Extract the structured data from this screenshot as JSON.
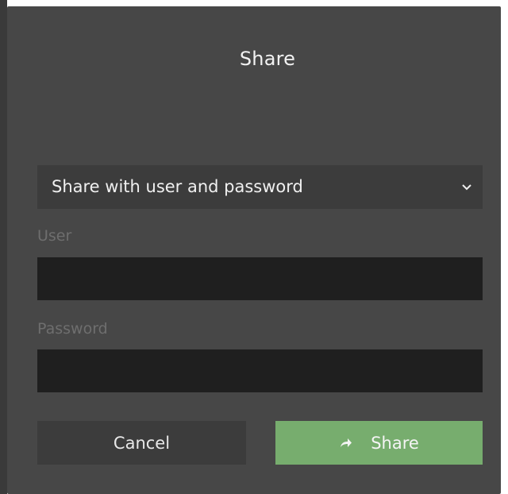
{
  "dialog": {
    "title": "Share"
  },
  "share_mode": {
    "selected": "Share with user and password"
  },
  "user": {
    "label": "User",
    "value": ""
  },
  "password": {
    "label": "Password",
    "value": ""
  },
  "buttons": {
    "cancel_label": "Cancel",
    "share_label": "Share"
  },
  "colors": {
    "dialog_bg": "#474747",
    "field_bg": "#1f1f1f",
    "select_bg": "#3c3c3c",
    "accent": "#77ad6e"
  },
  "icons": {
    "share": "share-arrow-icon",
    "dropdown": "chevron-down-icon"
  }
}
